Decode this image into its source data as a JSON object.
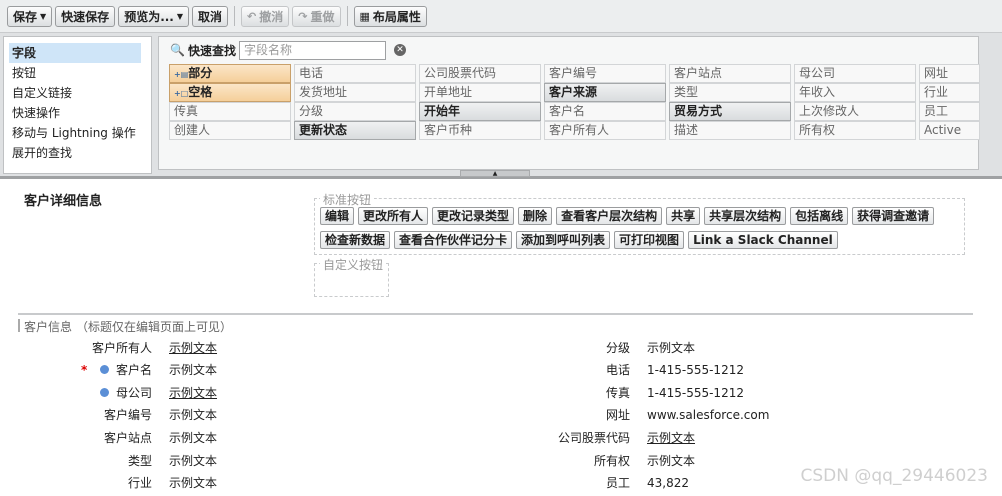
{
  "toolbar": {
    "save": "保存",
    "quick_save": "快速保存",
    "preview": "预览为...",
    "cancel": "取消",
    "undo": "撤消",
    "redo": "重做",
    "layout_props": "布局属性"
  },
  "palette": {
    "categories": [
      "字段",
      "按钮",
      "自定义链接",
      "快速操作",
      "移动与 Lightning 操作",
      "展开的查找"
    ],
    "selected_category": "字段",
    "quick_find_label": "快速查找",
    "quick_find_placeholder": "字段名称",
    "fields": [
      [
        "部分",
        "电话",
        "公司股票代码",
        "客户编号",
        "客户站点",
        "母公司",
        "网址"
      ],
      [
        "空格",
        "发货地址",
        "开单地址",
        "客户来源",
        "类型",
        "年收入",
        "行业"
      ],
      [
        "传真",
        "分级",
        "开始年",
        "客户名",
        "贸易方式",
        "上次修改人",
        "员工"
      ],
      [
        "创建人",
        "更新状态",
        "客户币种",
        "客户所有人",
        "描述",
        "所有权",
        "Active"
      ]
    ]
  },
  "detail": {
    "title": "客户详细信息",
    "std_buttons_label": "标准按钮",
    "std_buttons_row1": [
      "编辑",
      "更改所有人",
      "更改记录类型",
      "删除",
      "查看客户层次结构",
      "共享",
      "共享层次结构",
      "包括离线",
      "获得调查邀请"
    ],
    "std_buttons_row2": [
      "检查新数据",
      "查看合作伙伴记分卡",
      "添加到呼叫列表",
      "可打印视图",
      "Link a Slack Channel"
    ],
    "custom_buttons_label": "自定义按钮"
  },
  "section": {
    "title": "客户信息",
    "note": "（标题仅在编辑页面上可见）",
    "left": [
      {
        "label": "客户所有人",
        "value": "示例文本"
      },
      {
        "label": "客户名",
        "value": "示例文本"
      },
      {
        "label": "母公司",
        "value": "示例文本"
      },
      {
        "label": "客户编号",
        "value": "示例文本"
      },
      {
        "label": "客户站点",
        "value": "示例文本"
      },
      {
        "label": "类型",
        "value": "示例文本"
      },
      {
        "label": "行业",
        "value": "示例文本"
      }
    ],
    "right": [
      {
        "label": "分级",
        "value": "示例文本"
      },
      {
        "label": "电话",
        "value": "1-415-555-1212"
      },
      {
        "label": "传真",
        "value": "1-415-555-1212"
      },
      {
        "label": "网址",
        "value": "www.salesforce.com"
      },
      {
        "label": "公司股票代码",
        "value": "示例文本"
      },
      {
        "label": "所有权",
        "value": "示例文本"
      },
      {
        "label": "员工",
        "value": "43,822"
      }
    ]
  },
  "watermark": "CSDN @qq_29446023"
}
